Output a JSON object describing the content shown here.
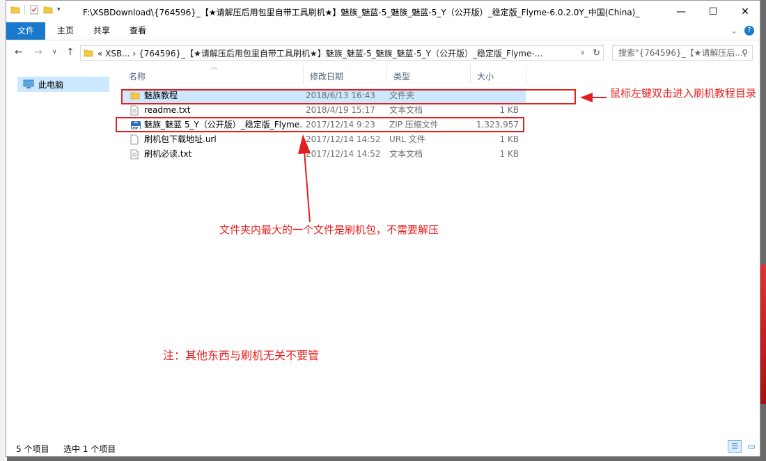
{
  "window": {
    "title": "F:\\XSBDownload\\{764596}_【★请解压后用包里自带工具刷机★】魅族_魅蓝-5_魅族_魅蓝-5_Y（公开版）_稳定版_Flyme-6.0.2.0Y_中国(China)_6.",
    "minimize": "—",
    "maximize": "☐",
    "close": "✕"
  },
  "ribbon": {
    "tabs": [
      "文件",
      "主页",
      "共享",
      "查看"
    ],
    "expand_glyph": "⌄",
    "help_glyph": "?"
  },
  "address": {
    "path": "« XSB... › {764596}_【★请解压后用包里自带工具刷机★】魅族_魅蓝-5_魅族_魅蓝-5_Y（公开版）_稳定版_Flyme-... ›",
    "search_placeholder": "搜索\"{764596}_【★请解压后..."
  },
  "nav": {
    "this_pc": "此电脑"
  },
  "columns": {
    "name": "名称",
    "date": "修改日期",
    "type": "类型",
    "size": "大小"
  },
  "files": [
    {
      "name": "魅族教程",
      "date": "2018/6/13 16:43",
      "type": "文件夹",
      "size": "",
      "icon": "folder-icon"
    },
    {
      "name": "readme.txt",
      "date": "2018/4/19 15:17",
      "type": "文本文档",
      "size": "1 KB",
      "icon": "text-file-icon"
    },
    {
      "name": "魅族_魅蓝 5_Y（公开版）_稳定版_Flyme...",
      "date": "2017/12/14 9:23",
      "type": "ZIP 压缩文件",
      "size": "1,323,957",
      "icon": "zip-file-icon"
    },
    {
      "name": "刷机包下载地址.url",
      "date": "2017/12/14 14:52",
      "type": "URL 文件",
      "size": "1 KB",
      "icon": "url-file-icon"
    },
    {
      "name": "刷机必读.txt",
      "date": "2017/12/14 14:52",
      "type": "文本文档",
      "size": "1 KB",
      "icon": "text-file-icon"
    }
  ],
  "status": {
    "count": "5 个项目",
    "selected": "选中 1 个项目"
  },
  "annotations": {
    "folder_hint": "鼠标左键双击进入刷机教程目录",
    "zip_hint": "文件夹内最大的一个文件是刷机包，不需要解压",
    "note": "注：其他东西与刷机无关不要管"
  },
  "colors": {
    "accent": "#1979ca",
    "selection": "#cce8ff",
    "annotation": "#e02020"
  }
}
